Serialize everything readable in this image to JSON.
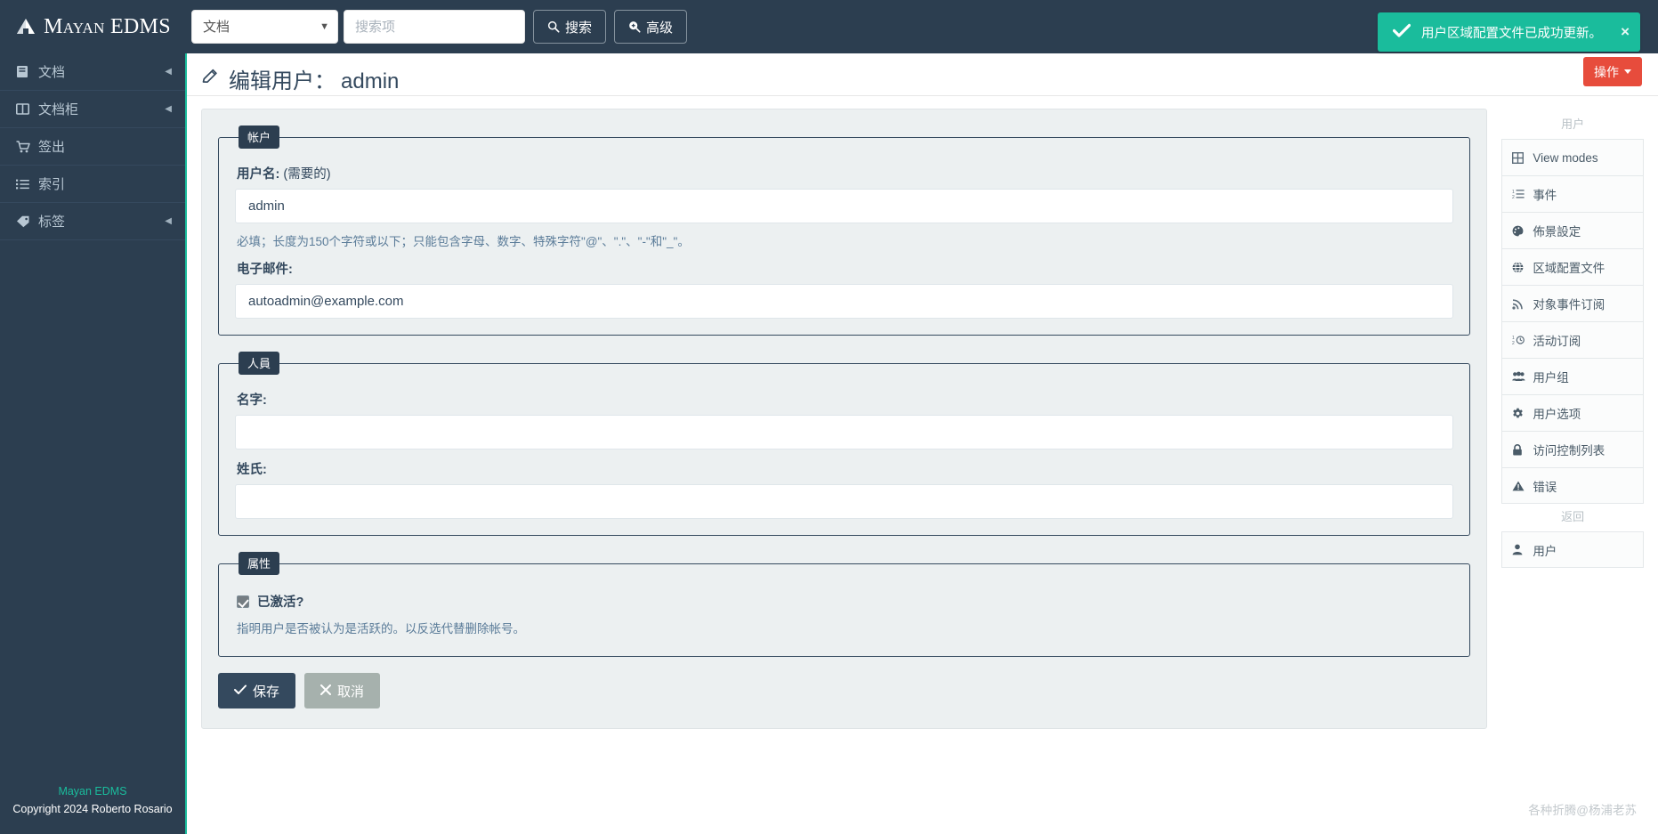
{
  "brand": {
    "name": "Mayan EDMS",
    "logo_icon": "pyramid-icon"
  },
  "topbar": {
    "scope_selected": "文档",
    "scope_options": [
      "文档"
    ],
    "search_placeholder": "搜索项",
    "search_value": "",
    "search_button": "搜索",
    "advanced_button": "高级",
    "search_icon": "magnifier-icon",
    "advanced_icon": "magnifier-plus-icon"
  },
  "toast": {
    "message": "用户区域配置文件已成功更新。",
    "icon": "check-icon",
    "close_icon": "close-icon",
    "color": "#1abc9c"
  },
  "sidebar": {
    "items": [
      {
        "label": "文档",
        "icon": "book-icon",
        "has_arrow": true
      },
      {
        "label": "文档柜",
        "icon": "columns-icon",
        "has_arrow": true
      },
      {
        "label": "签出",
        "icon": "cart-icon",
        "has_arrow": false
      },
      {
        "label": "索引",
        "icon": "list-icon",
        "has_arrow": false
      },
      {
        "label": "标签",
        "icon": "tag-icon",
        "has_arrow": true
      }
    ],
    "footer_brand": "Mayan EDMS",
    "footer_copyright": "Copyright 2024 Roberto Rosario",
    "accent_color": "#1abc9c"
  },
  "page": {
    "title": "编辑用户：",
    "username": "admin",
    "title_icon": "pencil-icon",
    "action_button": "操作",
    "action_button_color": "#e74c3c",
    "corner_note": "各种折腾@杨浦老苏"
  },
  "form": {
    "sections": [
      {
        "legend": "帐户",
        "fields": [
          {
            "label": "用户名:",
            "required_suffix": " (需要的)",
            "value": "admin",
            "help": "必填；长度为150个字符或以下；只能包含字母、数字、特殊字符\"@\"、\".\"、\"-\"和\"_\"。"
          },
          {
            "label": "电子邮件:",
            "required_suffix": "",
            "value": "autoadmin@example.com",
            "help": ""
          }
        ]
      },
      {
        "legend": "人員",
        "fields": [
          {
            "label": "名字:",
            "required_suffix": "",
            "value": "",
            "help": ""
          },
          {
            "label": "姓氏:",
            "required_suffix": "",
            "value": "",
            "help": ""
          }
        ]
      }
    ],
    "attributes": {
      "legend": "属性",
      "checkbox_label": "已激活?",
      "checkbox_checked": true,
      "help": "指明用户是否被认为是活跃的。以反选代替删除帐号。"
    },
    "save_button": "保存",
    "cancel_button": "取消",
    "save_icon": "check-icon",
    "cancel_icon": "x-icon"
  },
  "right_panel": {
    "heading": "用户",
    "items": [
      {
        "label": "View modes",
        "icon": "grid-icon"
      },
      {
        "label": "事件",
        "icon": "ordered-list-icon"
      },
      {
        "label": "佈景設定",
        "icon": "palette-icon"
      },
      {
        "label": "区域配置文件",
        "icon": "globe-icon"
      },
      {
        "label": "对象事件订阅",
        "icon": "rss-icon"
      },
      {
        "label": "活动订阅",
        "icon": "ordered-list-clock-icon"
      },
      {
        "label": "用户组",
        "icon": "users-icon"
      },
      {
        "label": "用户选项",
        "icon": "gear-icon"
      },
      {
        "label": "访问控制列表",
        "icon": "lock-icon"
      },
      {
        "label": "错误",
        "icon": "warning-triangle-icon"
      }
    ],
    "back_heading": "返回",
    "back_items": [
      {
        "label": "用户",
        "icon": "user-icon"
      }
    ]
  }
}
